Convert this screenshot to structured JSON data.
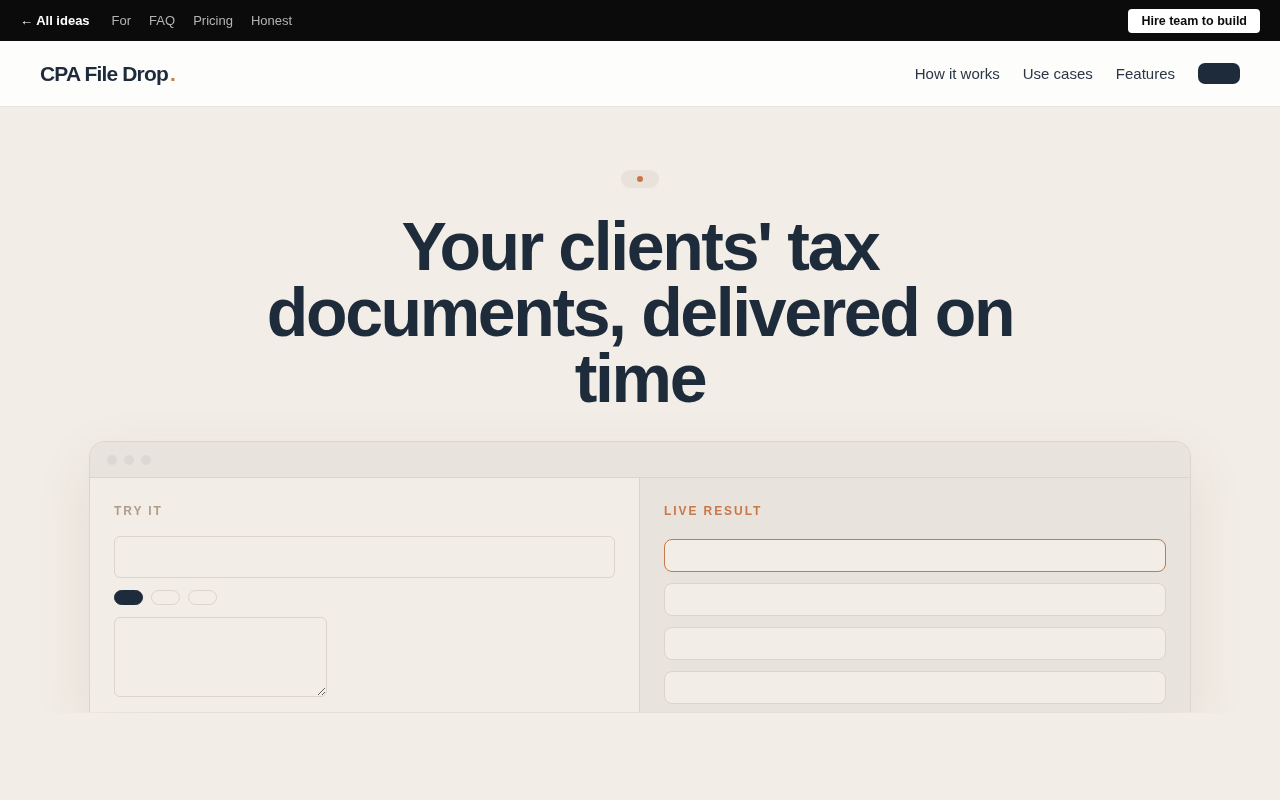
{
  "top_bar": {
    "links": [
      {
        "label": "← All ideas",
        "kind": "back"
      },
      {
        "label": "For",
        "kind": "section"
      },
      {
        "label": "FAQ",
        "kind": "section"
      },
      {
        "label": "Pricing",
        "kind": "section"
      },
      {
        "label": "Honest",
        "kind": "section"
      }
    ],
    "button": "Hire team to build"
  },
  "header": {
    "logo": {
      "name": "CPA File Drop",
      "dot": "."
    },
    "nav": [
      "How it works",
      "Use cases",
      "Features"
    ]
  },
  "hero": {
    "headline": "Your clients' tax documents, delivered on time"
  },
  "demo": {
    "try_panel": {
      "label": "TRY IT",
      "chips": [
        {
          "selected": true
        },
        {
          "selected": false
        },
        {
          "selected": false
        }
      ]
    },
    "result_panel": {
      "label": "LIVE RESULT",
      "rows": [
        {
          "highlighted": true
        },
        {
          "highlighted": false
        },
        {
          "highlighted": false
        },
        {
          "highlighted": false
        }
      ]
    }
  }
}
